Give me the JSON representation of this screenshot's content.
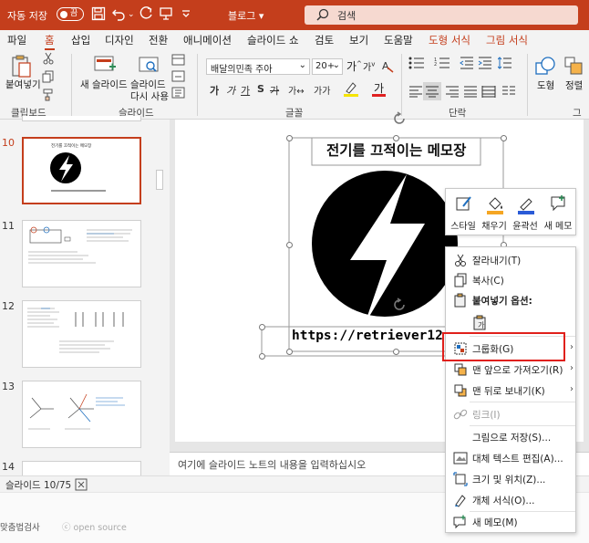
{
  "titlebar": {
    "autosave_label": "자동 저장",
    "autosave_state": "끔",
    "doc_name": "블로그",
    "search_placeholder": "검색"
  },
  "tabs": [
    "파일",
    "홈",
    "삽입",
    "디자인",
    "전환",
    "애니메이션",
    "슬라이드 쇼",
    "검토",
    "보기",
    "도움말",
    "도형 서식",
    "그림 서식"
  ],
  "ribbon": {
    "clipboard": {
      "label": "클립보드",
      "paste": "붙여넣기"
    },
    "slides": {
      "label": "슬라이드",
      "new_slide": "새 슬라이드",
      "reuse_line1": "슬라이드",
      "reuse_line2": "다시 사용"
    },
    "font": {
      "label": "글꼴",
      "font_name": "배달의민족 주아",
      "font_size": "20+",
      "grow": "가",
      "shrink": "가"
    },
    "paragraph": {
      "label": "단락"
    },
    "drawing": {
      "shape": "도형",
      "arrange": "정렬",
      "group_partial": "그리"
    }
  },
  "slide_pane": {
    "numbers": [
      "10",
      "11",
      "12",
      "13",
      "14"
    ],
    "selected": "10",
    "thumb10_title": "전기를 끄적이는 메모장"
  },
  "slide": {
    "title": "전기를 끄적이는 메모장",
    "url": "https://retriever12.tist"
  },
  "mini_toolbar": {
    "style": "스타일",
    "fill": "채우기",
    "outline": "윤곽선",
    "new_memo": "새 메모"
  },
  "context_menu": {
    "cut": "잘라내기(T)",
    "copy": "복사(C)",
    "paste_options": "붙여넣기 옵션:",
    "group": "그룹화(G)",
    "bring_front": "맨 앞으로 가져오기(R)",
    "send_back": "맨 뒤로 보내기(K)",
    "link": "링크(I)",
    "save_as_picture": "그림으로 저장(S)...",
    "alt_text": "대체 텍스트 편집(A)...",
    "size_position": "크기 및 위치(Z)...",
    "format_object": "개체 서식(O)...",
    "new_memo": "새 메모(M)"
  },
  "notes_placeholder": "여기에 슬라이드 노트의 내용을 입력하십시오",
  "status": {
    "slide_counter": "슬라이드 10/75"
  },
  "bottom": {
    "spell": "맞춤법검사",
    "open_source": "open source"
  },
  "colors": {
    "brand": "#c43e1c",
    "highlight": "#e0201b"
  }
}
